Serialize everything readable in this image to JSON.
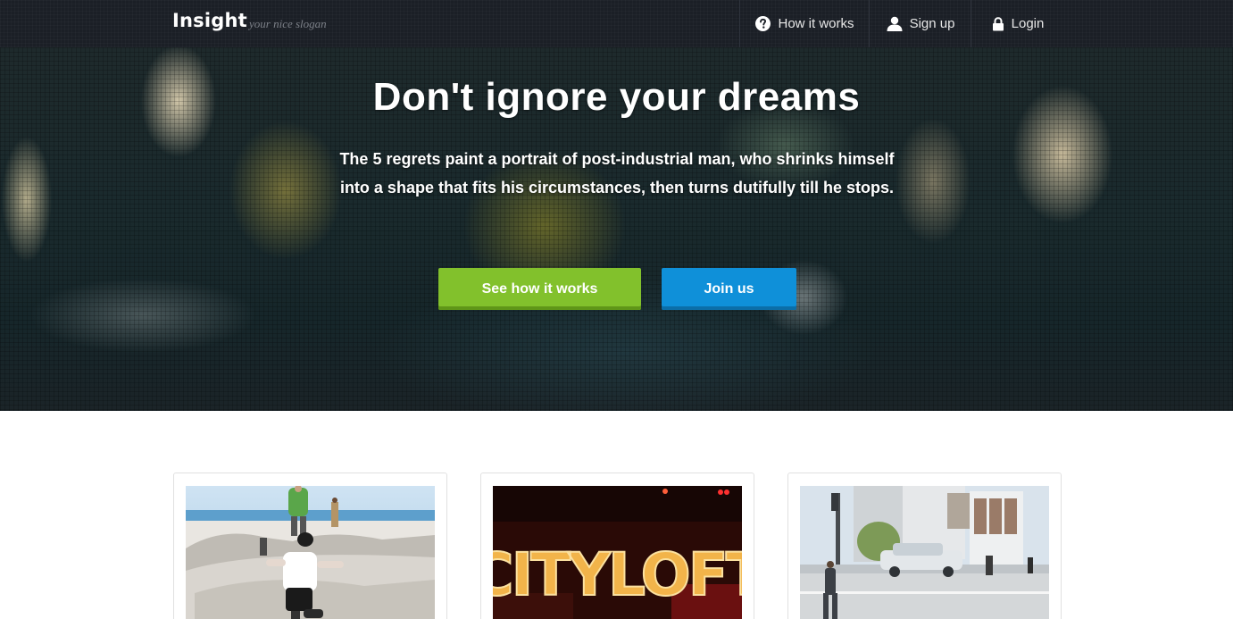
{
  "nav": {
    "brand": "Insight",
    "slogan": "your nice slogan",
    "items": [
      {
        "label": "How it works",
        "icon": "question-circle-icon"
      },
      {
        "label": "Sign up",
        "icon": "user-icon"
      },
      {
        "label": "Login",
        "icon": "lock-icon"
      }
    ]
  },
  "hero": {
    "title": "Don't ignore your dreams",
    "text": "The 5 regrets paint a portrait of post-industrial man, who shrinks himself into a shape that fits his circumstances, then turns dutifully till he stops.",
    "primary_button": "See how it works",
    "secondary_button": "Join us"
  },
  "colors": {
    "navbar_bg": "#1b1f26",
    "primary_button": "#82c12c",
    "secondary_button": "#0f90d9"
  },
  "cards": [
    {
      "image": "skatepark-photo"
    },
    {
      "image": "cityloft-sign-photo",
      "sign_text": "CITYLOFT"
    },
    {
      "image": "street-photo"
    }
  ]
}
